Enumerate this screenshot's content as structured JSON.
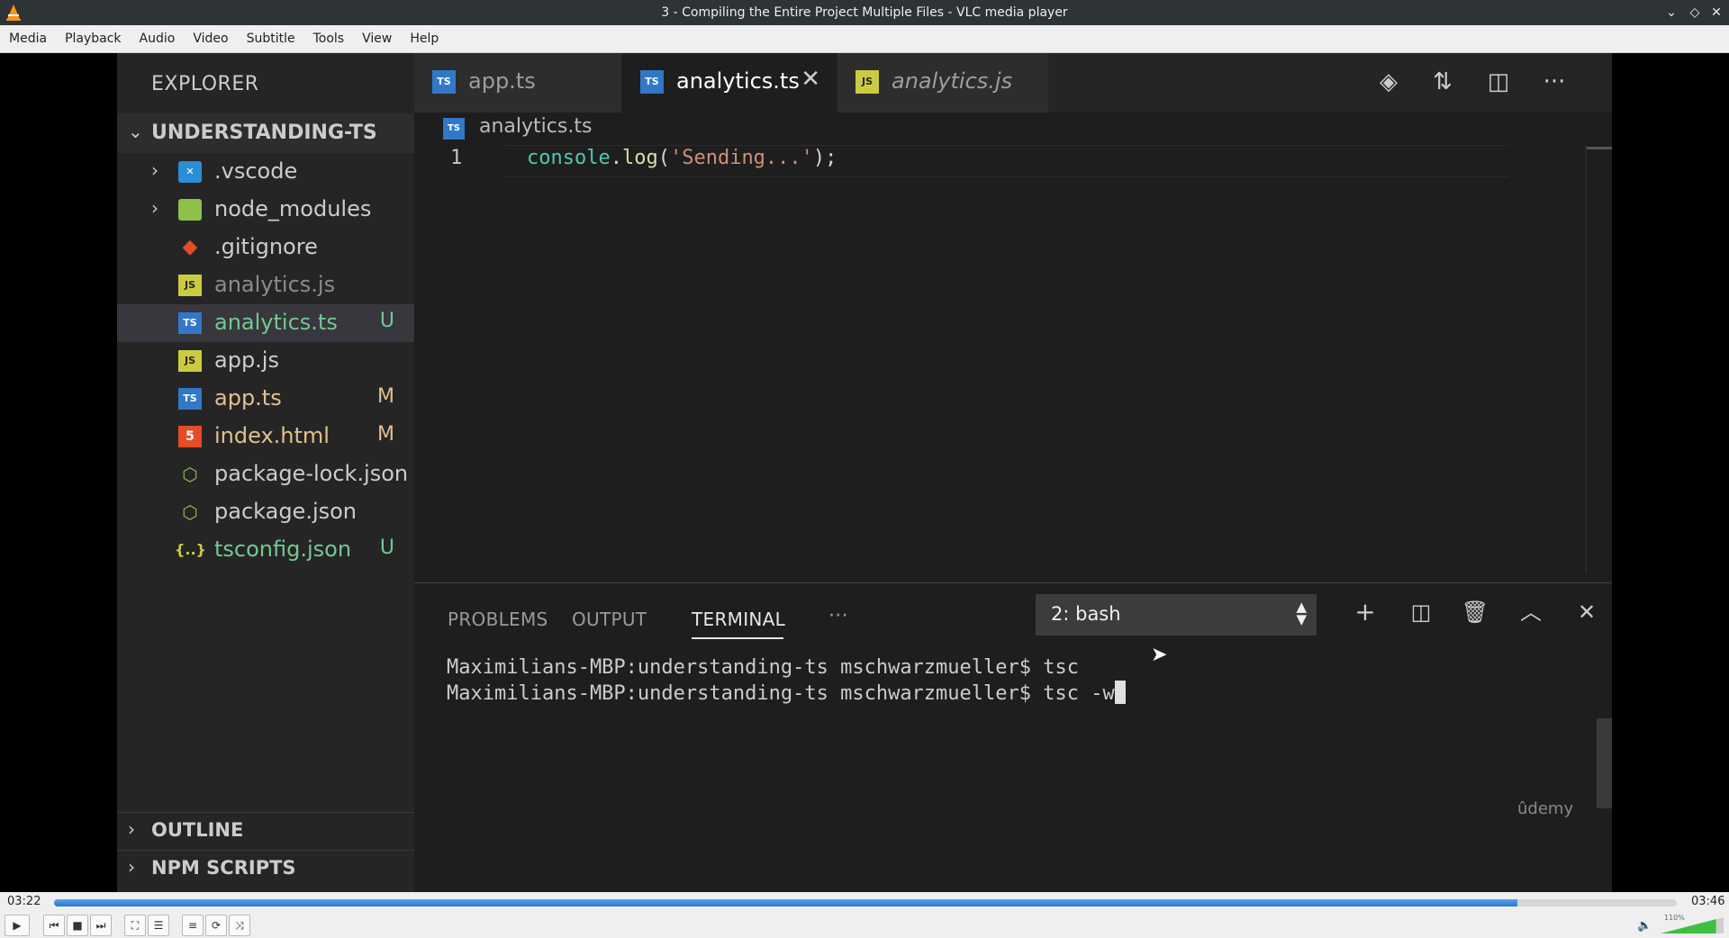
{
  "window": {
    "title": "3 - Compiling the Entire Project Multiple Files - VLC media player"
  },
  "menu": [
    "Media",
    "Playback",
    "Audio",
    "Video",
    "Subtitle",
    "Tools",
    "View",
    "Help"
  ],
  "explorer": {
    "title": "EXPLORER",
    "project": "UNDERSTANDING-TS",
    "items": [
      {
        "name": ".vscode",
        "badge": ""
      },
      {
        "name": "node_modules",
        "badge": ""
      },
      {
        "name": ".gitignore",
        "badge": ""
      },
      {
        "name": "analytics.js",
        "badge": ""
      },
      {
        "name": "analytics.ts",
        "badge": "U"
      },
      {
        "name": "app.js",
        "badge": ""
      },
      {
        "name": "app.ts",
        "badge": "M"
      },
      {
        "name": "index.html",
        "badge": "M"
      },
      {
        "name": "package-lock.json",
        "badge": ""
      },
      {
        "name": "package.json",
        "badge": ""
      },
      {
        "name": "tsconfig.json",
        "badge": "U"
      }
    ],
    "sections": [
      "OUTLINE",
      "NPM SCRIPTS"
    ]
  },
  "tabs": [
    {
      "name": "app.ts",
      "icon": "TS"
    },
    {
      "name": "analytics.ts",
      "icon": "TS",
      "close": "✕"
    },
    {
      "name": "analytics.js",
      "icon": "JS"
    }
  ],
  "breadcrumb": "analytics.ts",
  "editor": {
    "line_number": "1",
    "code": {
      "obj": "console",
      "dot": ".",
      "fn": "log",
      "open": "(",
      "str": "'Sending...'",
      "close": ");"
    }
  },
  "panel": {
    "tabs": [
      "PROBLEMS",
      "OUTPUT",
      "TERMINAL"
    ],
    "more": "···",
    "shell": "2: bash",
    "terminal": {
      "line1": "Maximilians-MBP:understanding-ts mschwarzmueller$ tsc",
      "line2": "Maximilians-MBP:understanding-ts mschwarzmueller$ tsc -w"
    },
    "watermark": "ûdemy"
  },
  "player": {
    "elapsed": "03:22",
    "total": "03:46",
    "progress": 0.902,
    "volume_label": "110%",
    "volume": 1.1
  },
  "colors": {
    "ts_icon": "#3178c6",
    "js_icon": "#cbcb41",
    "git_icon": "#e44d26",
    "html_icon": "#e44d26",
    "json_icon": "#8dc149",
    "untracked": "#73c991",
    "modified": "#e2c08d"
  }
}
